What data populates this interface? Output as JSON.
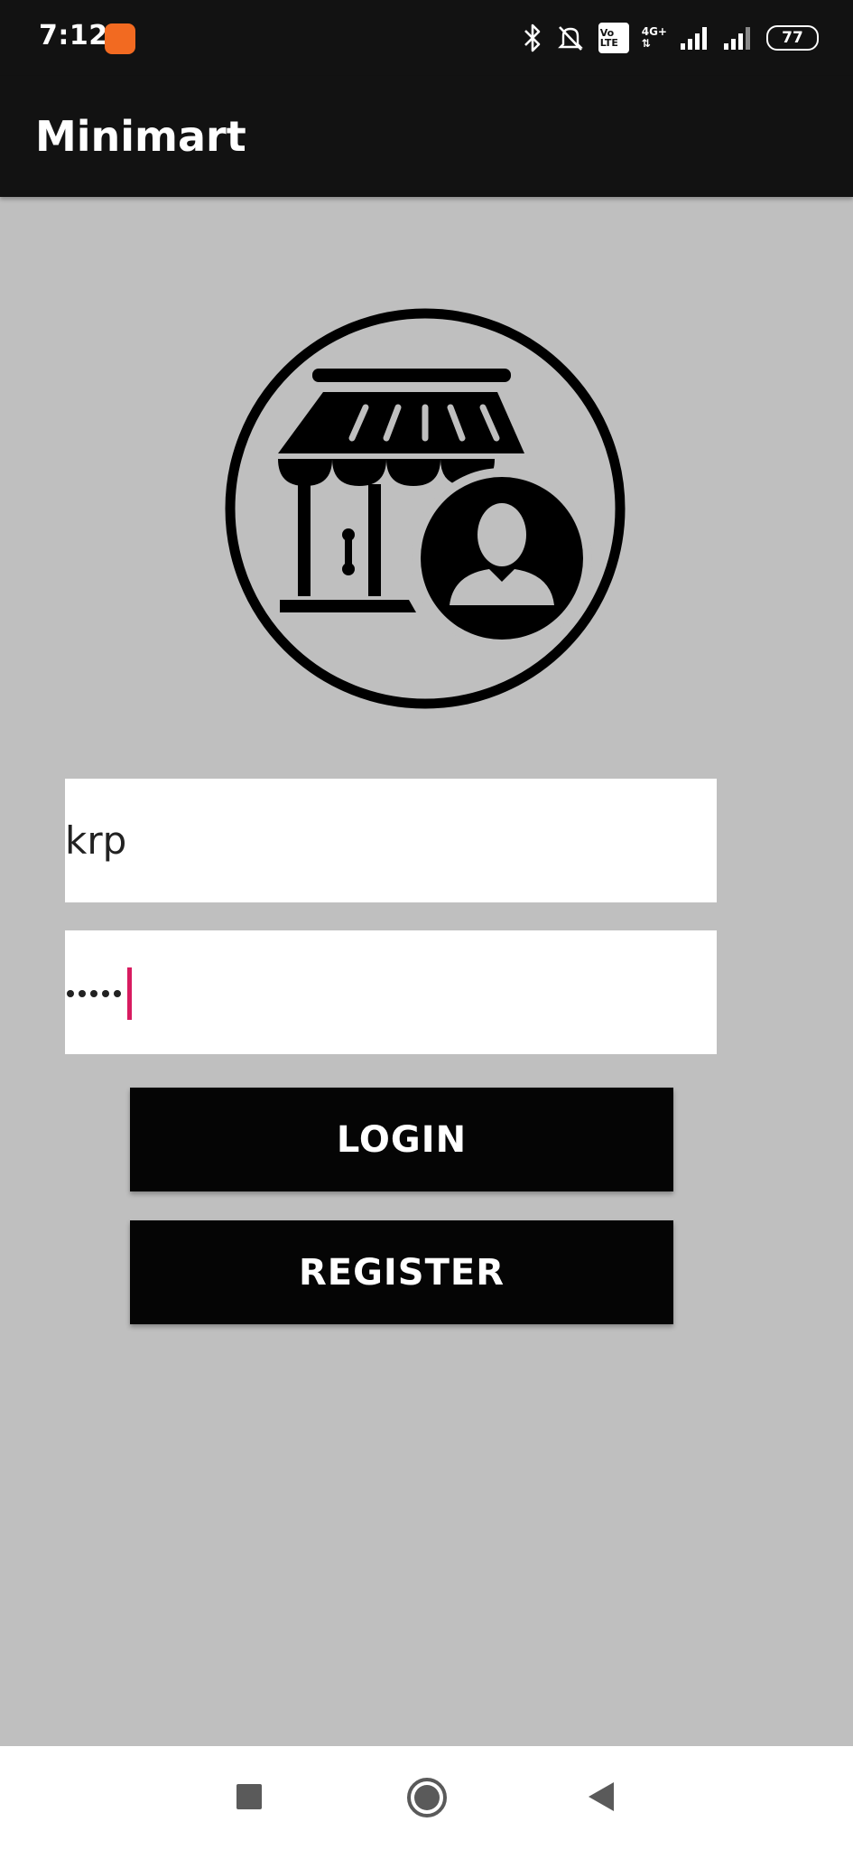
{
  "status_bar": {
    "time": "7:12",
    "battery": "77",
    "network_label": "4G+",
    "volte_label": "Vo LTE",
    "icons": [
      "bluetooth-icon",
      "bell-off-icon",
      "volte-icon",
      "signal-icon",
      "signal-icon",
      "battery-icon"
    ]
  },
  "app_bar": {
    "title": "Minimart"
  },
  "logo": {
    "icon": "store-user-icon"
  },
  "form": {
    "username_value": "krp",
    "password_length": 5,
    "caret_color": "#d81b60"
  },
  "buttons": {
    "login_label": "LOGIN",
    "register_label": "REGISTER"
  },
  "nav_bar": {
    "icons": [
      "recents-square-icon",
      "home-circle-icon",
      "back-triangle-icon"
    ]
  },
  "colors": {
    "background": "#bfbfbf",
    "bar": "#121212",
    "button": "#050505",
    "input": "#ffffff"
  }
}
